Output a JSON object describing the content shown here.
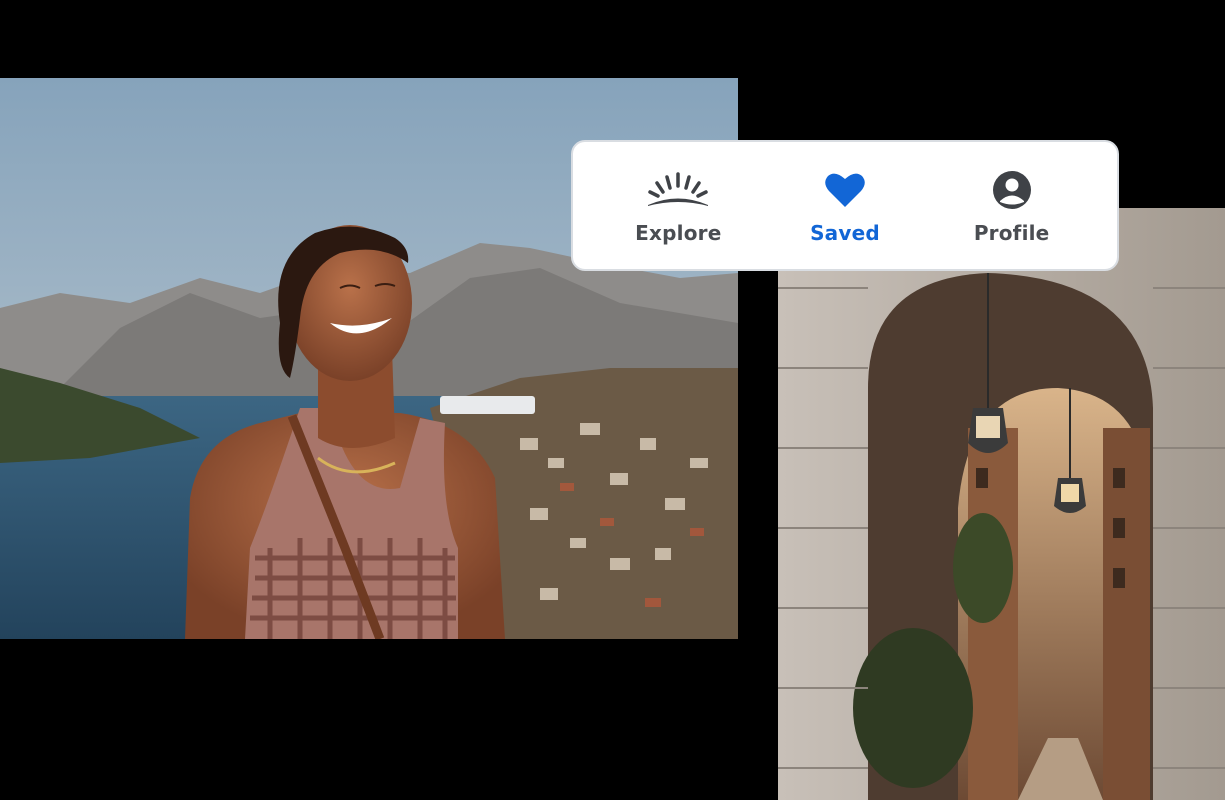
{
  "tabbar": {
    "tabs": [
      {
        "id": "explore",
        "label": "Explore",
        "icon": "sunrise-icon",
        "active": false
      },
      {
        "id": "saved",
        "label": "Saved",
        "icon": "heart-icon",
        "active": true
      },
      {
        "id": "profile",
        "label": "Profile",
        "icon": "person-circle-icon",
        "active": false
      }
    ]
  },
  "colors": {
    "background": "#000000",
    "active_tab": "#1266d6",
    "inactive_tab": "#4a4d52",
    "card": "#ffffff"
  }
}
